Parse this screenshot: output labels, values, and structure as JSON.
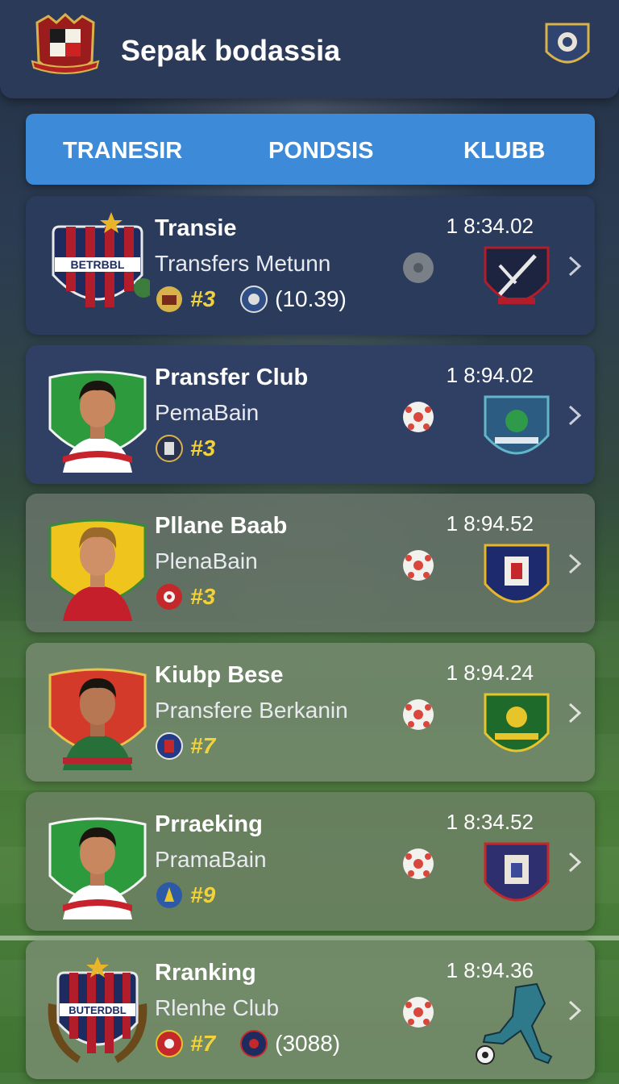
{
  "header": {
    "title": "Sepak bodassia"
  },
  "tabs": [
    {
      "label": "TRANESIR"
    },
    {
      "label": "PONDSIS"
    },
    {
      "label": "KLUBB"
    }
  ],
  "items": [
    {
      "name": "Transie",
      "subtitle": "Transfers Metunn",
      "rank": "#3",
      "extra": "(10.39)",
      "time": "1 8:34.02",
      "ball": "grey"
    },
    {
      "name": "Pransfer Club",
      "subtitle": "PemaBain",
      "rank": "#3",
      "extra": "",
      "time": "1 8:94.02",
      "ball": "red"
    },
    {
      "name": "Pllane Baab",
      "subtitle": "PlenaBain",
      "rank": "#3",
      "extra": "",
      "time": "1 8:94.52",
      "ball": "red"
    },
    {
      "name": "Kiubp Bese",
      "subtitle": "Pransfere Berkanin",
      "rank": "#7",
      "extra": "",
      "time": "1 8:94.24",
      "ball": "red"
    },
    {
      "name": "Prraeking",
      "subtitle": "PramaBain",
      "rank": "#9",
      "extra": "",
      "time": "1 8:34.52",
      "ball": "red"
    },
    {
      "name": "Rranking",
      "subtitle": "Rlenhe Club",
      "rank": "#7",
      "extra": "(3088)",
      "time": "1 8:94.36",
      "ball": "red"
    }
  ],
  "crest_text": {
    "club_1": "BETRBBL",
    "club_6": "BUTERDBL"
  },
  "colors": {
    "header_bg": "#2b3a59",
    "tab_bar": "#3d8ad8",
    "rank_yellow": "#f1d23a"
  }
}
